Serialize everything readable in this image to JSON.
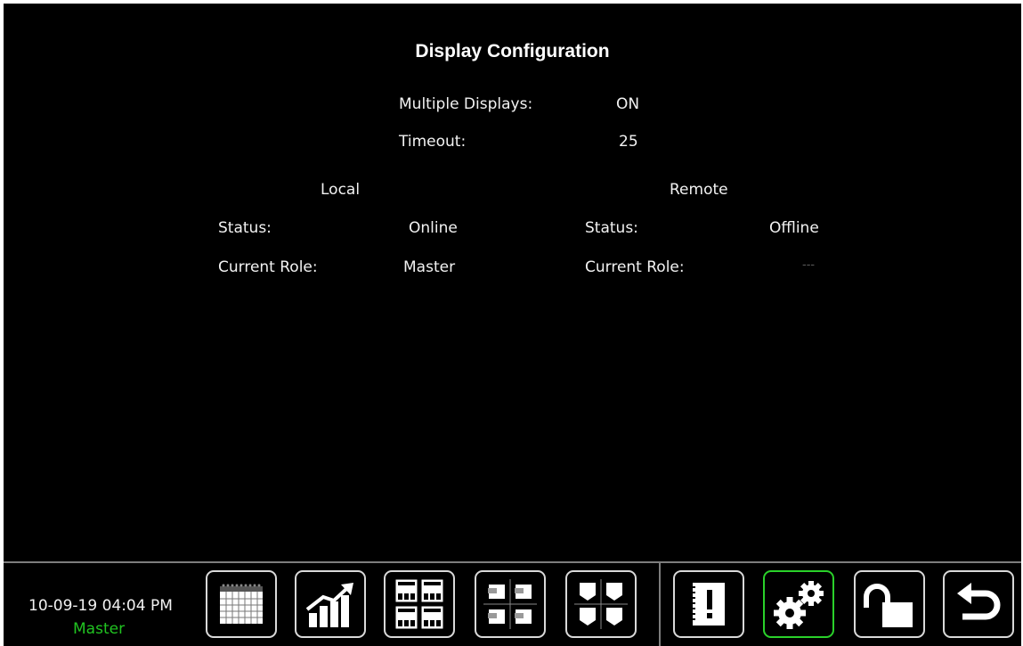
{
  "page": {
    "title": "Display Configuration"
  },
  "settings": {
    "multiple_displays_label": "Multiple Displays:",
    "multiple_displays_value": "ON",
    "timeout_label": "Timeout:",
    "timeout_value": "25"
  },
  "local": {
    "heading": "Local",
    "status_label": "Status:",
    "status_value": "Online",
    "role_label": "Current Role:",
    "role_value": "Master"
  },
  "remote": {
    "heading": "Remote",
    "status_label": "Status:",
    "status_value": "Offline",
    "role_label": "Current Role:",
    "role_value": "---"
  },
  "footer": {
    "datetime": "10-09-19 04:04 PM",
    "role": "Master",
    "buttons": [
      {
        "icon": "calendar-icon",
        "active": false
      },
      {
        "icon": "trend-chart-icon",
        "active": false
      },
      {
        "icon": "panel-grid-icon",
        "active": false
      },
      {
        "icon": "tank-labels-icon",
        "active": false
      },
      {
        "icon": "tanks-icon",
        "active": false
      },
      {
        "icon": "alarm-notebook-icon",
        "active": false
      },
      {
        "icon": "gears-icon",
        "active": true
      },
      {
        "icon": "unlock-icon",
        "active": false
      },
      {
        "icon": "back-arrow-icon",
        "active": false
      }
    ]
  },
  "colors": {
    "background": "#000000",
    "accent_green": "#21c321",
    "button_border": "#d9d9d9"
  }
}
